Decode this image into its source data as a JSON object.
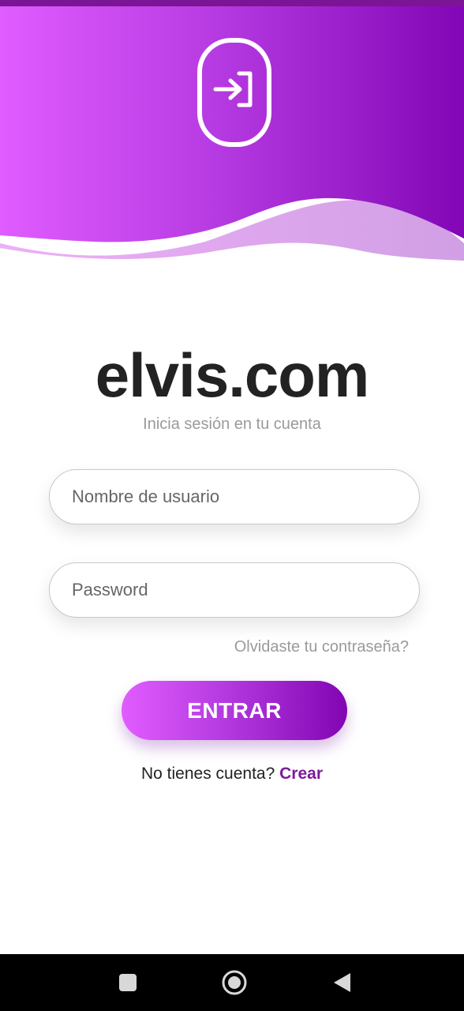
{
  "header": {
    "icon": "login-icon",
    "colors": {
      "gradient_start": "#e05cff",
      "gradient_end": "#8206b5"
    }
  },
  "brand": {
    "title": "elvis.com",
    "subtitle": "Inicia sesión en tu cuenta"
  },
  "form": {
    "username_placeholder": "Nombre de usuario",
    "username_value": "",
    "password_placeholder": "Password",
    "password_value": "",
    "forgot_label": "Olvidaste tu contraseña?",
    "submit_label": "ENTRAR",
    "signup_prompt": "No tienes cuenta?",
    "signup_link_label": "Crear"
  },
  "navigation_bar": {
    "buttons": [
      "square-recents-icon",
      "circle-home-icon",
      "triangle-back-icon"
    ]
  },
  "colors": {
    "accent": "#7d1a9e",
    "title_text": "#222222",
    "muted_text": "#9a9a9a"
  }
}
